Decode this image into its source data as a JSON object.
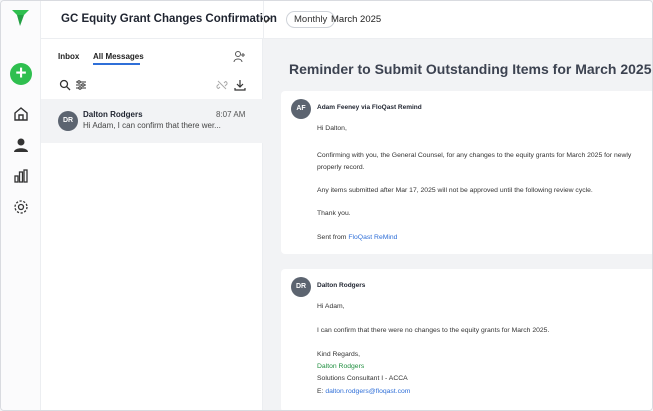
{
  "header": {
    "title": "GC Equity Grant Changes Confirmation",
    "frequency": "Monthly",
    "period": "March 2025"
  },
  "colors": {
    "accent": "#2fbf4f",
    "link": "#2f6fd8",
    "signature": "#1e8e3e",
    "avatar": "#5c6470"
  },
  "rail": {
    "icons": [
      "logo-icon",
      "add-icon",
      "home-icon",
      "user-icon",
      "chart-icon",
      "settings-icon"
    ]
  },
  "inbox": {
    "tabs": [
      "Inbox",
      "All Messages"
    ],
    "active_tab": "All Messages",
    "items": [
      {
        "initials": "DR",
        "sender": "Dalton Rodgers",
        "time": "8:07 AM",
        "preview": "Hi Adam, I can confirm that there wer..."
      }
    ]
  },
  "thread": {
    "subject": "Reminder to Submit Outstanding Items for March 2025",
    "messages": [
      {
        "initials": "AF",
        "from": "Adam Feeney via FloQast Remind",
        "greeting": "Hi Dalton,",
        "body1_line1": "Confirming with you, the General Counsel, for any changes to the equity grants for March 2025 for newly",
        "body1_line2": "properly record.",
        "body2": "Any items submitted after Mar 17, 2025 will not be approved until the following review cycle.",
        "thanks": "Thank you.",
        "sent_from": "Sent from",
        "sent_link": "FloQast ReMind"
      },
      {
        "initials": "DR",
        "from": "Dalton Rodgers",
        "greeting": "Hi Adam,",
        "body": "I can confirm that there were no changes to the equity grants for March 2025.",
        "signoff": "Kind Regards,",
        "sig_name": "Dalton Rodgers",
        "sig_title": "Solutions Consultant I - ACCA",
        "sig_email_label": "E:",
        "sig_email": "dalton.rodgers@floqast.com"
      }
    ]
  }
}
